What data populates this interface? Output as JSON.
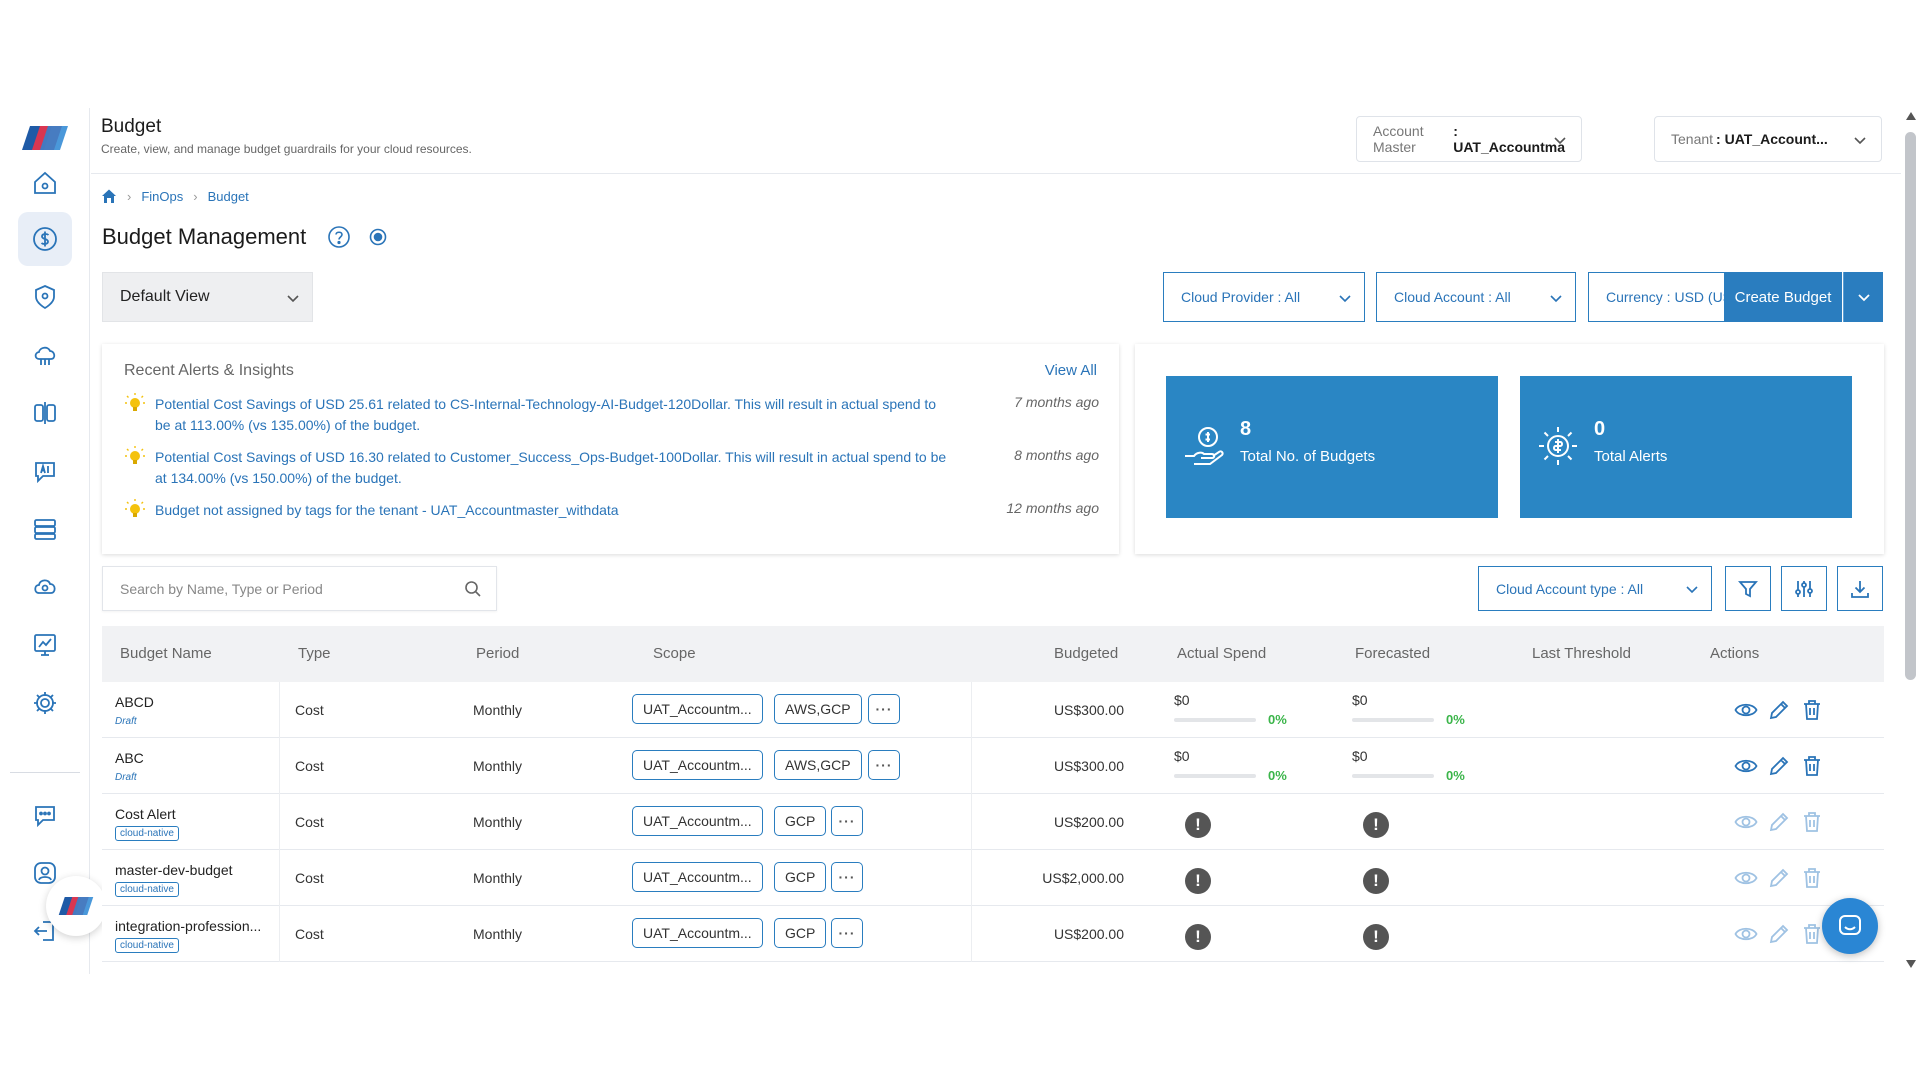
{
  "header": {
    "title": "Budget",
    "subtitle": "Create, view, and manage budget guardrails for your cloud resources.",
    "account_master_label": "Account Master",
    "account_master_value": ": UAT_Accountma",
    "tenant_label": "Tenant",
    "tenant_value": ": UAT_Account..."
  },
  "breadcrumb": {
    "level1": "FinOps",
    "level2": "Budget"
  },
  "page": {
    "title": "Budget Management"
  },
  "filters": {
    "view": "Default View",
    "cloud_provider": "Cloud Provider : All",
    "cloud_account": "Cloud Account : All",
    "currency": "Currency : USD (US$)",
    "create_label": "Create Budget",
    "cloud_account_type": "Cloud Account type : All",
    "search_placeholder": "Search by Name, Type or Period"
  },
  "alerts": {
    "heading": "Recent Alerts & Insights",
    "view_all": "View All",
    "items": [
      {
        "text": "Potential Cost Savings of USD 25.61 related to CS-Internal-Technology-AI-Budget-120Dollar. This will result in actual spend to be at 113.00% (vs 135.00%) of the budget.",
        "time": "7 months ago"
      },
      {
        "text": "Potential Cost Savings of USD 16.30 related to Customer_Success_Ops-Budget-100Dollar. This will result in actual spend to be at 134.00% (vs 150.00%) of the budget.",
        "time": "8 months ago"
      },
      {
        "text": "Budget not assigned by tags for the tenant - UAT_Accountmaster_withdata",
        "time": "12 months ago"
      }
    ]
  },
  "kpis": {
    "budgets": {
      "value": "8",
      "label": "Total No. of Budgets"
    },
    "alerts": {
      "value": "0",
      "label": "Total Alerts"
    }
  },
  "table": {
    "headers": {
      "name": "Budget Name",
      "type": "Type",
      "period": "Period",
      "scope": "Scope",
      "budgeted": "Budgeted",
      "actual": "Actual Spend",
      "forecasted": "Forecasted",
      "threshold": "Last Threshold",
      "actions": "Actions"
    },
    "rows": [
      {
        "name": "ABCD",
        "status": "Draft",
        "tag": "",
        "type": "Cost",
        "period": "Monthly",
        "scope1": "UAT_Accountm...",
        "scope2": "AWS,GCP",
        "more": "···",
        "budgeted": "US$300.00",
        "actual": "$0",
        "actual_pct": "0%",
        "forecast": "$0",
        "forecast_pct": "0%"
      },
      {
        "name": "ABC",
        "status": "Draft",
        "tag": "",
        "type": "Cost",
        "period": "Monthly",
        "scope1": "UAT_Accountm...",
        "scope2": "AWS,GCP",
        "more": "···",
        "budgeted": "US$300.00",
        "actual": "$0",
        "actual_pct": "0%",
        "forecast": "$0",
        "forecast_pct": "0%"
      },
      {
        "name": "Cost Alert",
        "status": "",
        "tag": "cloud-native",
        "type": "Cost",
        "period": "Monthly",
        "scope1": "UAT_Accountm...",
        "scope2": "GCP",
        "more": "···",
        "budgeted": "US$200.00"
      },
      {
        "name": "master-dev-budget",
        "status": "",
        "tag": "cloud-native",
        "type": "Cost",
        "period": "Monthly",
        "scope1": "UAT_Accountm...",
        "scope2": "GCP",
        "more": "···",
        "budgeted": "US$2,000.00"
      },
      {
        "name": "integration-profession...",
        "status": "",
        "tag": "cloud-native",
        "type": "Cost",
        "period": "Monthly",
        "scope1": "UAT_Accountm...",
        "scope2": "GCP",
        "more": "···",
        "budgeted": "US$200.00"
      }
    ]
  },
  "colors": {
    "accent": "#2a7dbf",
    "kpi": "#2a86c4",
    "success": "#3bb54a"
  }
}
